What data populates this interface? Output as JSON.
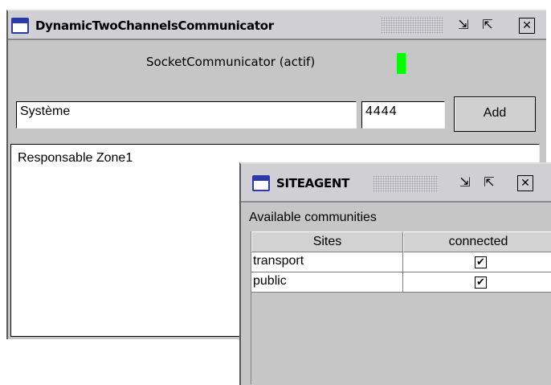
{
  "main_window": {
    "title": "DynamicTwoChannelsCommunicator",
    "status_label": "SocketCommunicator (actif)",
    "status_color": "#00ff00",
    "name_field_value": "Système",
    "port_field_value": "4444",
    "add_button_label": "Add",
    "log_text": "Responsable Zone1"
  },
  "site_window": {
    "title": "SITEAGENT",
    "section_label": "Available communities",
    "columns": [
      "Sites",
      "connected"
    ],
    "rows": [
      {
        "site": "transport",
        "connected_mark": "✔"
      },
      {
        "site": "public",
        "connected_mark": "✔"
      }
    ]
  },
  "icons": {
    "minimize": "⇲",
    "maximize": "⇱",
    "close": "✕"
  }
}
